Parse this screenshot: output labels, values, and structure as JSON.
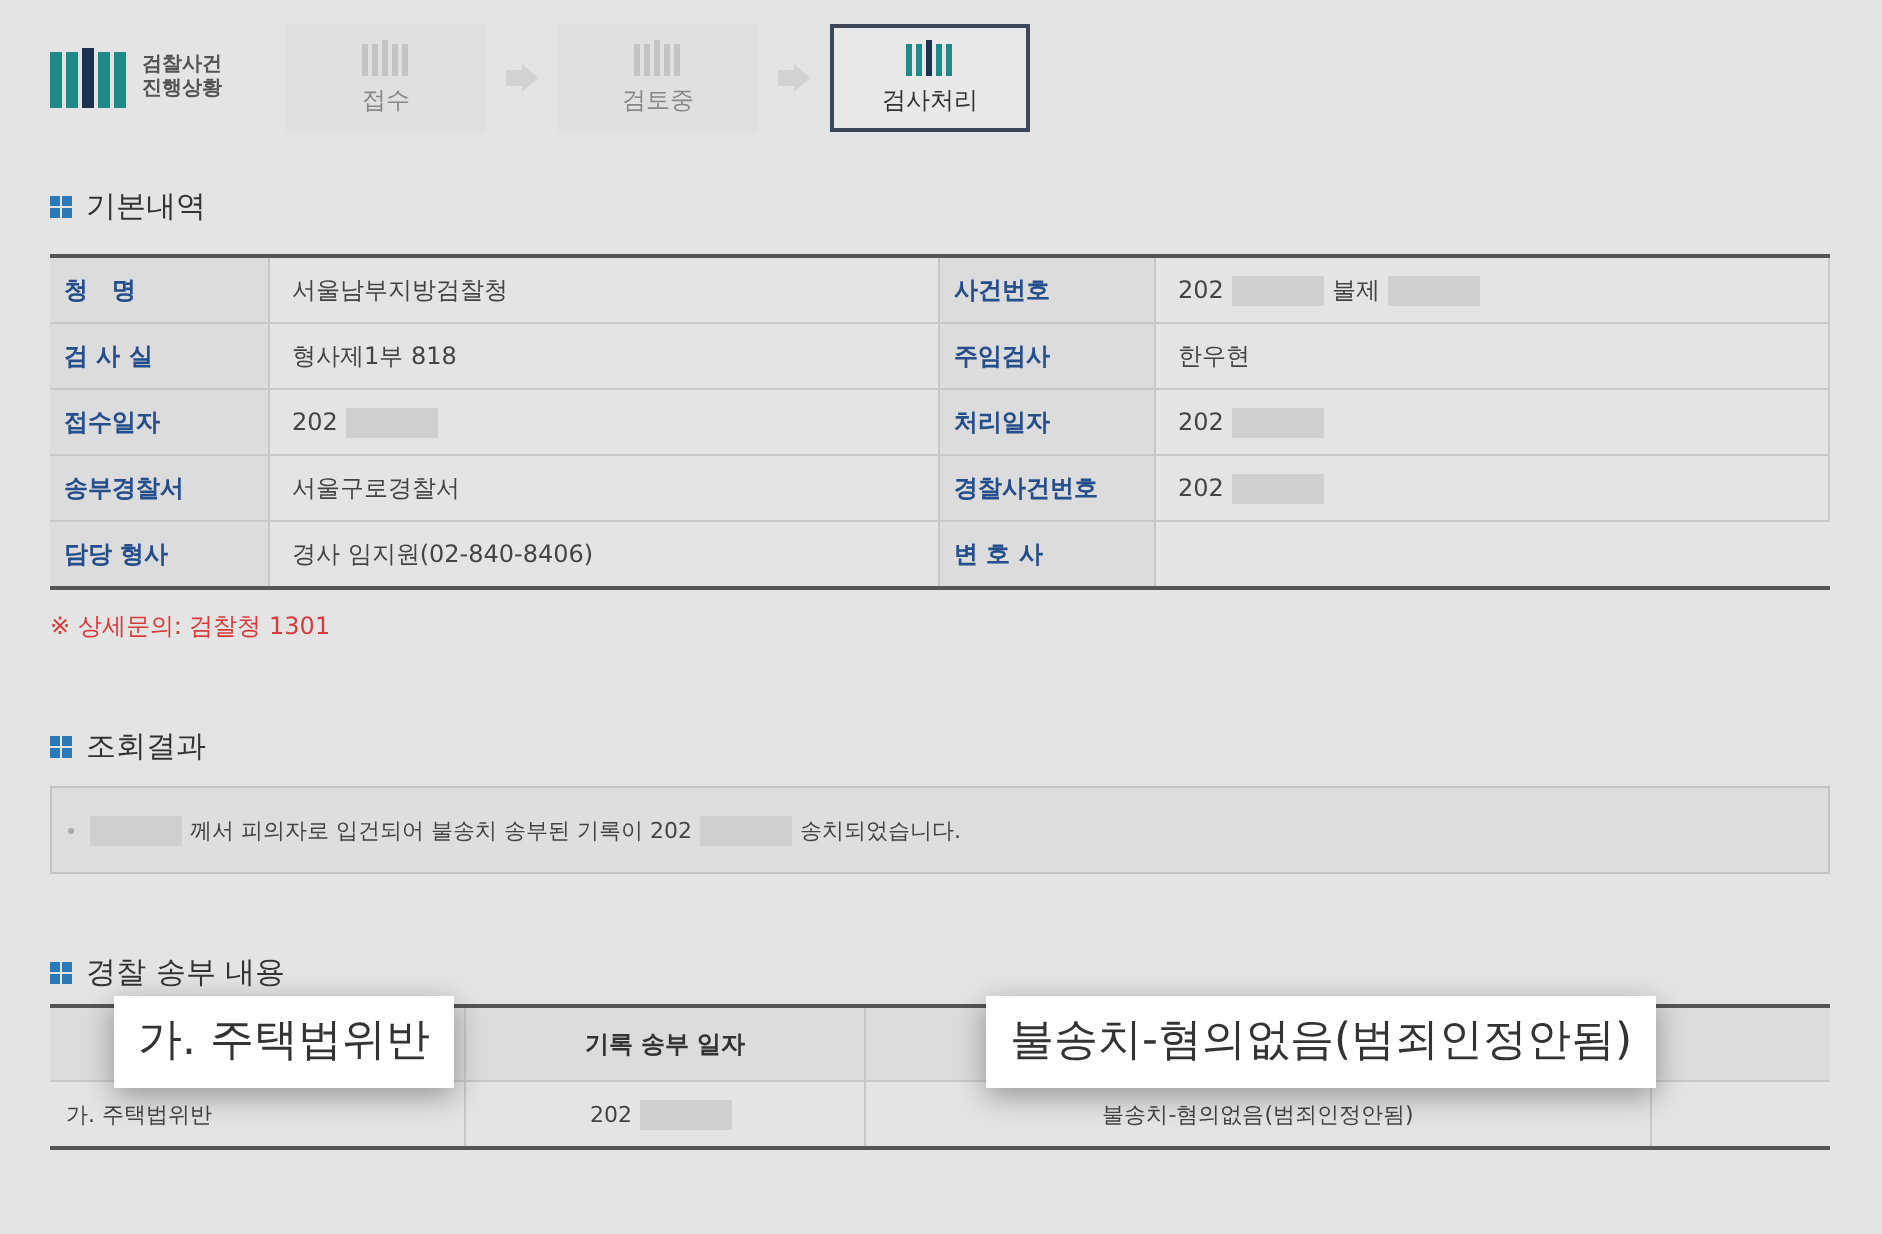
{
  "header": {
    "logo_text": [
      "검찰사건",
      "진행상황"
    ],
    "steps": [
      {
        "label": "접수",
        "selected": false
      },
      {
        "label": "검토중",
        "selected": false
      },
      {
        "label": "검사처리",
        "selected": true
      }
    ]
  },
  "basic_info": {
    "title": "기본내역",
    "rows": [
      {
        "left_label": "청　명",
        "left_value": [
          {
            "kind": "text",
            "text": "서울남부지방검찰청"
          }
        ],
        "right_label": "사건번호",
        "right_value": [
          {
            "kind": "text",
            "text": "202"
          },
          {
            "kind": "redacted"
          },
          {
            "kind": "text",
            "text": "불제"
          },
          {
            "kind": "redacted"
          }
        ]
      },
      {
        "left_label": "검 사 실",
        "left_value": [
          {
            "kind": "text",
            "text": "형사제1부 818"
          }
        ],
        "right_label": "주임검사",
        "right_value": [
          {
            "kind": "text",
            "text": "한우현"
          }
        ]
      },
      {
        "left_label": "접수일자",
        "left_value": [
          {
            "kind": "text",
            "text": "202"
          },
          {
            "kind": "redacted"
          }
        ],
        "right_label": "처리일자",
        "right_value": [
          {
            "kind": "text",
            "text": "202"
          },
          {
            "kind": "redacted"
          }
        ]
      },
      {
        "left_label": "송부경찰서",
        "left_value": [
          {
            "kind": "text",
            "text": "서울구로경찰서"
          }
        ],
        "right_label": "경찰사건번호",
        "right_value": [
          {
            "kind": "text",
            "text": "202"
          },
          {
            "kind": "redacted"
          }
        ]
      },
      {
        "left_label": "담당 형사",
        "left_value": [
          {
            "kind": "text",
            "text": "경사 임지원(02-840-8406)"
          }
        ],
        "right_label": "변 호 사"
      }
    ],
    "note": "※ 상세문의: 검찰청 1301"
  },
  "result": {
    "title": "조회결과",
    "sentence": [
      {
        "kind": "redacted"
      },
      {
        "kind": "text",
        "text": "께서 피의자로 입건되어 불송치 송부된 기록이 202"
      },
      {
        "kind": "redacted"
      },
      {
        "kind": "text",
        "text": "송치되었습니다."
      }
    ]
  },
  "police": {
    "title": "경찰 송부 내용",
    "header": {
      "column_2": "기록 송부 일자"
    },
    "rows": [
      {
        "column_1": "가. 주택법위반",
        "column_2": [
          {
            "kind": "text",
            "text": "202"
          },
          {
            "kind": "redacted"
          }
        ],
        "column_3": "불송치-혐의없음(범죄인정안됨)"
      }
    ]
  },
  "callouts": [
    {
      "text": "가. 주택법위반"
    },
    {
      "text": "불송치-혐의없음(범죄인정안됨)"
    }
  ]
}
